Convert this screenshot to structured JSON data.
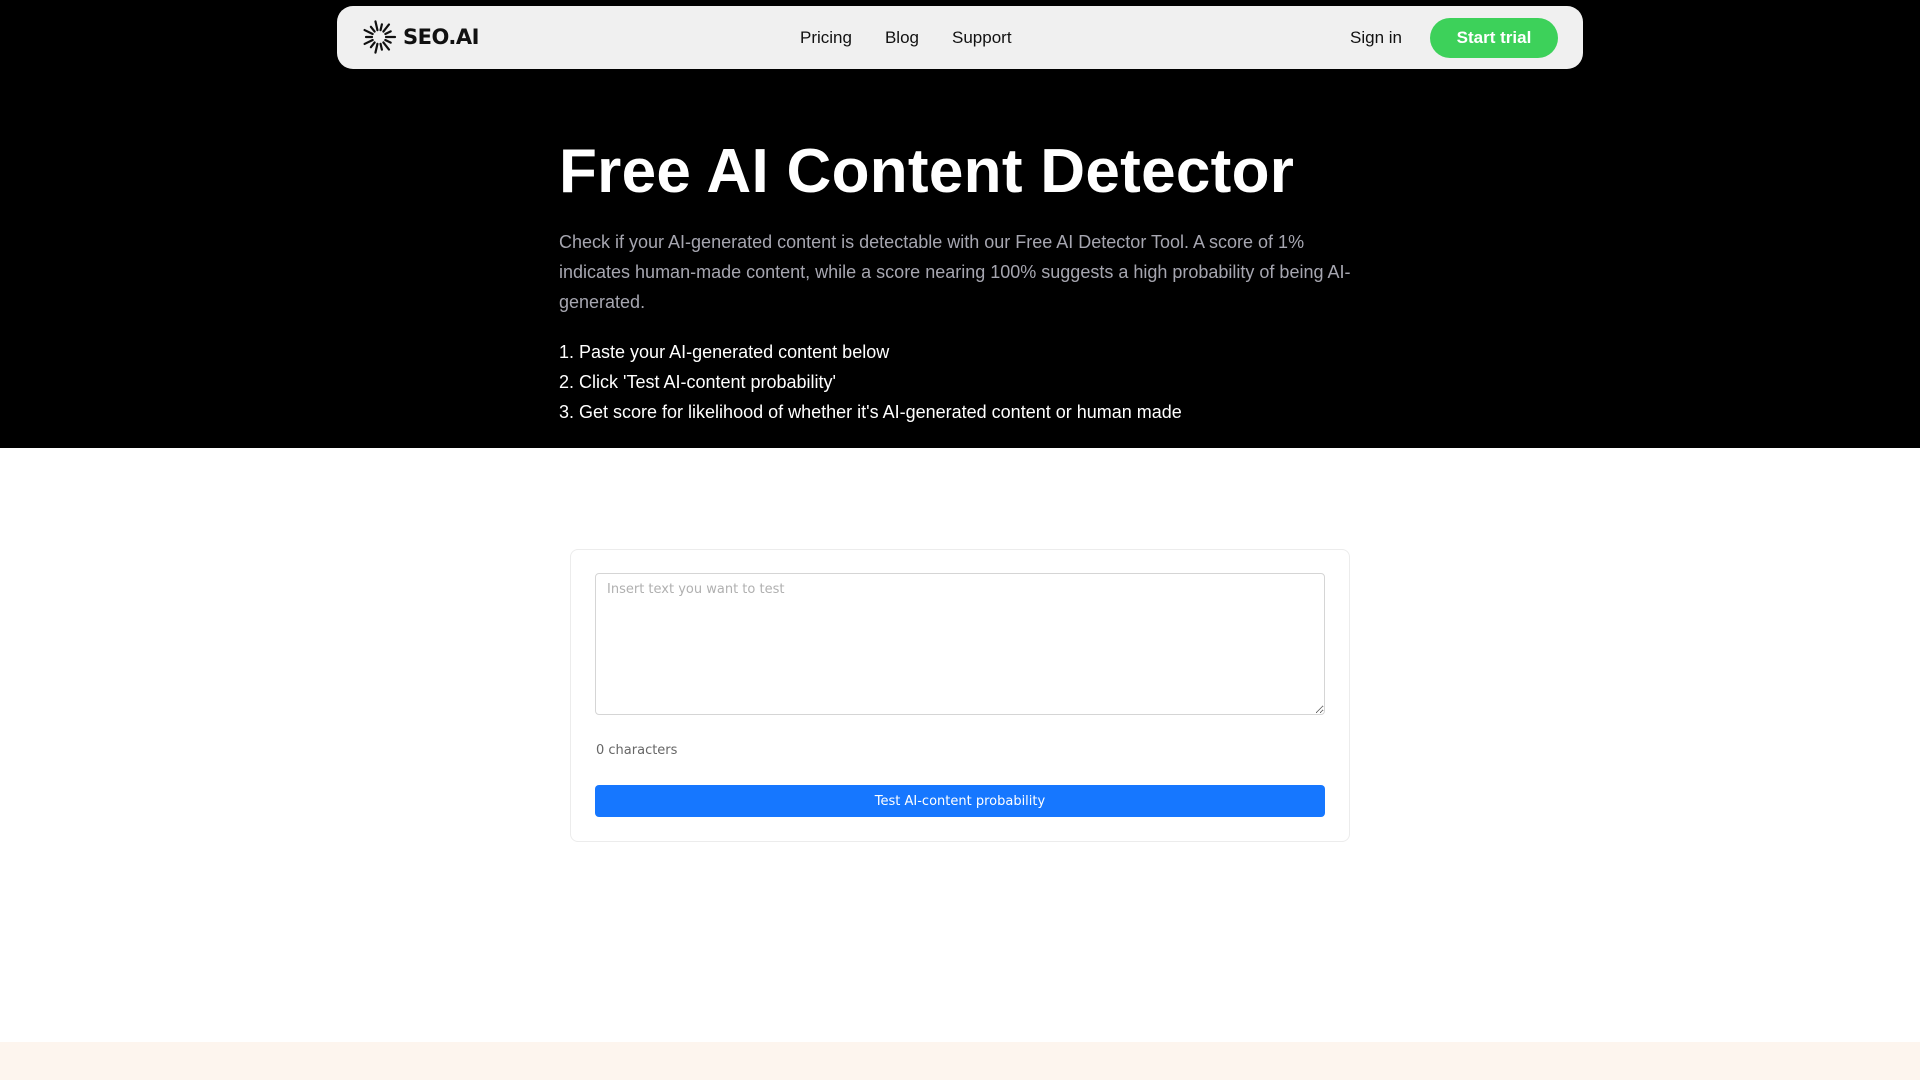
{
  "header": {
    "logo_text": "SEO.AI",
    "logo_icon": "sunburst-icon",
    "nav": [
      {
        "label": "Pricing"
      },
      {
        "label": "Blog"
      },
      {
        "label": "Support"
      }
    ],
    "signin_label": "Sign in",
    "cta_label": "Start trial"
  },
  "hero": {
    "title": "Free AI Content Detector",
    "description": "Check if your AI-generated content is detectable with our Free AI Detector Tool. A score of 1% indicates human-made content, while a score nearing 100% suggests a high probability of being AI-generated.",
    "steps": [
      "1. Paste your AI-generated content below",
      "2. Click 'Test AI-content probability'",
      "3. Get score for likelihood of whether it's AI-generated content or human made"
    ]
  },
  "tool": {
    "input_placeholder": "Insert text you want to test",
    "input_value": "",
    "char_count": "0 characters",
    "button_label": "Test AI-content probability"
  },
  "colors": {
    "hero_bg": "#000000",
    "nav_bg": "#f0f0f0",
    "cta_green": "#3dd15a",
    "button_blue": "#1677ff",
    "footer_band": "#fdf5ee"
  }
}
